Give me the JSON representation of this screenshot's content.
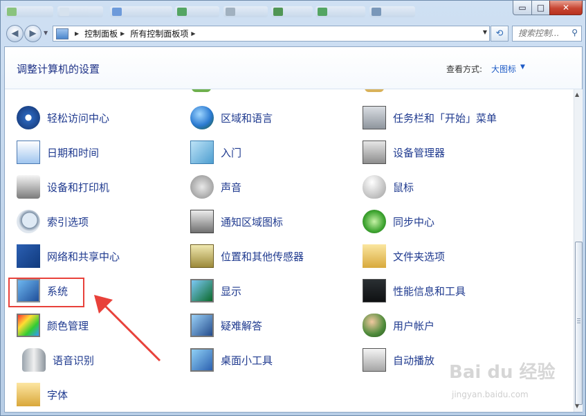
{
  "window": {
    "controls": {
      "minimize": "▭",
      "maximize": "□",
      "close": "✕"
    }
  },
  "nav": {
    "breadcrumb": [
      "控制面板",
      "所有控制面板项"
    ],
    "search_placeholder": "搜索控制..."
  },
  "header": {
    "title": "调整计算机的设置",
    "view_label": "查看方式:",
    "view_value": "大图标"
  },
  "items": [
    {
      "label": "轻松访问中心",
      "icon": "ease-of-access-icon"
    },
    {
      "label": "区域和语言",
      "icon": "region-language-icon"
    },
    {
      "label": "任务栏和「开始」菜单",
      "icon": "taskbar-icon"
    },
    {
      "label": "日期和时间",
      "icon": "date-time-icon"
    },
    {
      "label": "入门",
      "icon": "getting-started-icon"
    },
    {
      "label": "设备管理器",
      "icon": "device-manager-icon"
    },
    {
      "label": "设备和打印机",
      "icon": "printer-icon"
    },
    {
      "label": "声音",
      "icon": "speaker-icon"
    },
    {
      "label": "鼠标",
      "icon": "mouse-icon"
    },
    {
      "label": "索引选项",
      "icon": "indexing-icon"
    },
    {
      "label": "通知区域图标",
      "icon": "notification-area-icon"
    },
    {
      "label": "同步中心",
      "icon": "sync-center-icon"
    },
    {
      "label": "网络和共享中心",
      "icon": "network-icon"
    },
    {
      "label": "位置和其他传感器",
      "icon": "location-sensor-icon"
    },
    {
      "label": "文件夹选项",
      "icon": "folder-options-icon"
    },
    {
      "label": "系统",
      "icon": "system-icon"
    },
    {
      "label": "显示",
      "icon": "display-icon"
    },
    {
      "label": "性能信息和工具",
      "icon": "performance-icon"
    },
    {
      "label": "颜色管理",
      "icon": "color-management-icon"
    },
    {
      "label": "疑难解答",
      "icon": "troubleshooting-icon"
    },
    {
      "label": "用户帐户",
      "icon": "user-accounts-icon"
    },
    {
      "label": "语音识别",
      "icon": "microphone-icon"
    },
    {
      "label": "桌面小工具",
      "icon": "gadgets-icon"
    },
    {
      "label": "自动播放",
      "icon": "autoplay-icon"
    },
    {
      "label": "字体",
      "icon": "fonts-icon"
    }
  ],
  "watermark": {
    "brand": "Bai du 经验",
    "url": "jingyan.baidu.com"
  },
  "colors": {
    "link": "#1f3a8f",
    "title": "#1e3287",
    "highlight": "#e8413a"
  }
}
